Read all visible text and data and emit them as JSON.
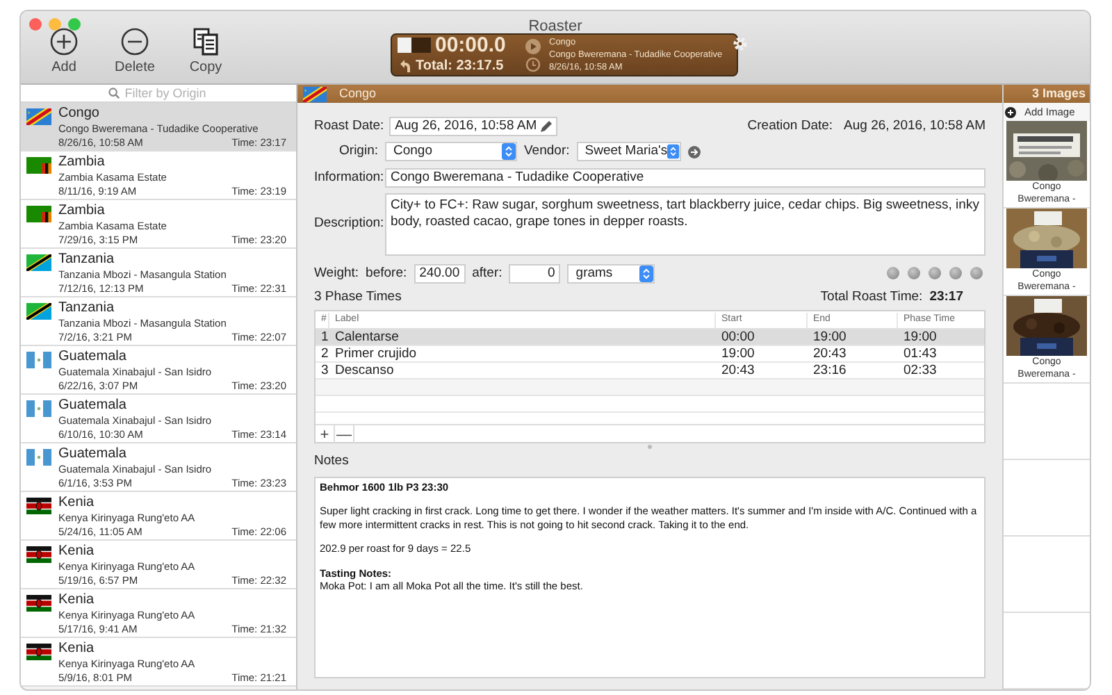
{
  "window": {
    "title": "Roaster"
  },
  "toolbar": [
    {
      "label": "Add",
      "kind": "add"
    },
    {
      "label": "Delete",
      "kind": "delete"
    },
    {
      "label": "Copy",
      "kind": "copy"
    }
  ],
  "timer": {
    "time": "00:00.0",
    "total": "Total: 23:17.5",
    "origin": "Congo",
    "info": "Congo Bweremana - Tudadike Cooperative",
    "date": "8/26/16, 10:58 AM"
  },
  "sidebar": {
    "search": {
      "placeholder": "Filter by Origin"
    },
    "items": [
      {
        "origin": "Congo",
        "info": "Congo Bweremana - Tudadike Cooperative",
        "date": "8/26/16, 10:58 AM",
        "time": "Time: 23:17",
        "kind": "congo",
        "selected": true
      },
      {
        "origin": "Zambia",
        "info": "Zambia Kasama Estate",
        "date": "8/11/16, 9:19 AM",
        "time": "Time: 23:19",
        "kind": "zambia",
        "selected": false
      },
      {
        "origin": "Zambia",
        "info": "Zambia Kasama Estate",
        "date": "7/29/16, 3:15 PM",
        "time": "Time: 23:20",
        "kind": "zambia",
        "selected": false
      },
      {
        "origin": "Tanzania",
        "info": "Tanzania Mbozi - Masangula Station",
        "date": "7/12/16, 12:13 PM",
        "time": "Time: 22:31",
        "kind": "tanzania",
        "selected": false
      },
      {
        "origin": "Tanzania",
        "info": "Tanzania Mbozi - Masangula Station",
        "date": "7/2/16, 3:21 PM",
        "time": "Time: 22:07",
        "kind": "tanzania",
        "selected": false
      },
      {
        "origin": "Guatemala",
        "info": "Guatemala Xinabajul - San Isidro",
        "date": "6/22/16, 3:07 PM",
        "time": "Time: 23:20",
        "kind": "guatemala",
        "selected": false
      },
      {
        "origin": "Guatemala",
        "info": "Guatemala Xinabajul - San Isidro",
        "date": "6/10/16, 10:30 AM",
        "time": "Time: 23:14",
        "kind": "guatemala",
        "selected": false
      },
      {
        "origin": "Guatemala",
        "info": "Guatemala Xinabajul - San Isidro",
        "date": "6/1/16, 3:53 PM",
        "time": "Time: 23:23",
        "kind": "guatemala",
        "selected": false
      },
      {
        "origin": "Kenia",
        "info": "Kenya Kirinyaga Rung'eto AA",
        "date": "5/24/16, 11:05 AM",
        "time": "Time: 22:06",
        "kind": "kenya",
        "selected": false
      },
      {
        "origin": "Kenia",
        "info": "Kenya Kirinyaga Rung'eto AA",
        "date": "5/19/16, 6:57 PM",
        "time": "Time: 22:32",
        "kind": "kenya",
        "selected": false
      },
      {
        "origin": "Kenia",
        "info": "Kenya Kirinyaga Rung'eto AA",
        "date": "5/17/16, 9:41 AM",
        "time": "Time: 21:32",
        "kind": "kenya",
        "selected": false
      },
      {
        "origin": "Kenia",
        "info": "Kenya Kirinyaga Rung'eto AA",
        "date": "5/9/16, 8:01 PM",
        "time": "Time: 21:21",
        "kind": "kenya",
        "selected": false
      }
    ]
  },
  "detail": {
    "title": "Congo",
    "kind": "congo",
    "roast_date_label": "Roast Date:",
    "roast_date": "Aug 26, 2016, 10:58 AM",
    "creation_date_label": "Creation Date:",
    "creation_date": "Aug 26, 2016, 10:58 AM",
    "origin_label": "Origin:",
    "origin": "Congo",
    "vendor_label": "Vendor:",
    "vendor": "Sweet Maria's",
    "information_label": "Information:",
    "information": "Congo Bweremana - Tudadike Cooperative",
    "description_label": "Description:",
    "description": "City+ to FC+: Raw sugar, sorghum sweetness, tart blackberry juice, cedar chips. Big sweetness, inky body, roasted cacao, grape tones in depper roasts.",
    "weight_label": "Weight:",
    "before_label": "before:",
    "before": "240.00",
    "after_label": "after:",
    "after": "0",
    "unit": "grams",
    "rating": {
      "stars": 0
    },
    "phases_title": "3 Phase Times",
    "total_label": "Total Roast Time:",
    "total": "23:17",
    "table": {
      "columns": [
        "#",
        "Label",
        "Start",
        "End",
        "Phase Time"
      ],
      "rows": [
        {
          "cells": [
            "1",
            "Calentarse",
            "00:00",
            "19:00",
            "19:00"
          ],
          "selected": true
        },
        {
          "cells": [
            "2",
            "Primer crujido",
            "19:00",
            "20:43",
            "01:43"
          ],
          "selected": false
        },
        {
          "cells": [
            "3",
            "Descanso",
            "20:43",
            "23:16",
            "02:33"
          ],
          "selected": false
        }
      ]
    },
    "table_buttons": [
      "+",
      "—"
    ],
    "notes_label": "Notes",
    "notes": [
      [
        {
          "kind": "heading",
          "text": "Behmor 1600 1lb P3 23:30"
        }
      ],
      [
        {
          "kind": "text",
          "text": "Super light cracking in first crack. Long time to get there. I wonder if the weather matters. It's summer and I'm inside with A/C. Continued with a few more intermittent cracks in rest. This is not going to hit second crack. Taking it to the end."
        }
      ],
      [
        {
          "kind": "text",
          "text": "202.9 per roast for 9 days = 22.5"
        }
      ],
      [
        {
          "kind": "heading",
          "text": "Tasting Notes:"
        },
        {
          "kind": "text",
          "text": "Moka Pot: I am all Moka Pot all the time. It's still the best."
        }
      ]
    ]
  },
  "images": {
    "count": "3 Images",
    "add": "Add Image",
    "items": [
      {
        "caption": "Congo Bweremana -",
        "kind": "sign"
      },
      {
        "caption": "Congo Bweremana -",
        "kind": "green"
      },
      {
        "caption": "Congo Bweremana -",
        "kind": "roasted"
      }
    ]
  }
}
